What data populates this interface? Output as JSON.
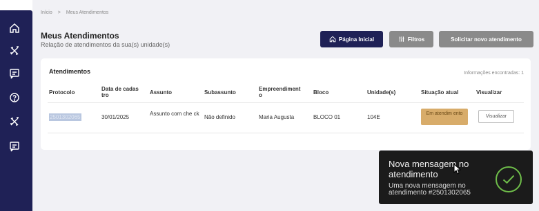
{
  "sidebar": {
    "items": [
      {
        "icon": "home-icon"
      },
      {
        "icon": "tools-icon"
      },
      {
        "icon": "message-icon"
      },
      {
        "icon": "help-icon"
      },
      {
        "icon": "tools-icon"
      },
      {
        "icon": "message-icon"
      }
    ],
    "color": "#1f2156"
  },
  "breadcrumb": {
    "home": "Início",
    "separator": ">",
    "current": "Meus Atendimentos"
  },
  "header": {
    "title": "Meus Atendimentos",
    "subtitle": "Relação de atendimentos da sua(s) unidade(s)"
  },
  "toolbar": {
    "home_label": "Página Inicial",
    "filters_label": "Filtros",
    "new_label": "Solicitar novo atendimento"
  },
  "table": {
    "title": "Atendimentos",
    "found_text": "Informações encontradas: 1",
    "columns": [
      "Protocolo",
      "Data de cadas tro",
      "Assunto",
      "Subassunto",
      "Empreendiment o",
      "Bloco",
      "Unidade(s)",
      "Situação atual",
      "Visualizar"
    ],
    "rows": [
      {
        "protocolo": "2501302065",
        "data": "30/01/2025",
        "assunto": "Assunto com che ck",
        "subassunto": "Não definido",
        "empreendimento": "Maria Augusta",
        "bloco": "BLOCO 01",
        "unidade": "104E",
        "situacao": "Em atendim ento",
        "visualizar": "Visualizar"
      }
    ]
  },
  "toast": {
    "title": "Nova mensagem no atendimento",
    "message": "Uma nova mensagem no atendimento #2501302065",
    "icon": "check-icon",
    "accent": "#6fbe4a"
  },
  "colors": {
    "primary": "#1f2156",
    "secondary_button": "#8a8a8a",
    "status_badge": "#d8ac6a"
  }
}
